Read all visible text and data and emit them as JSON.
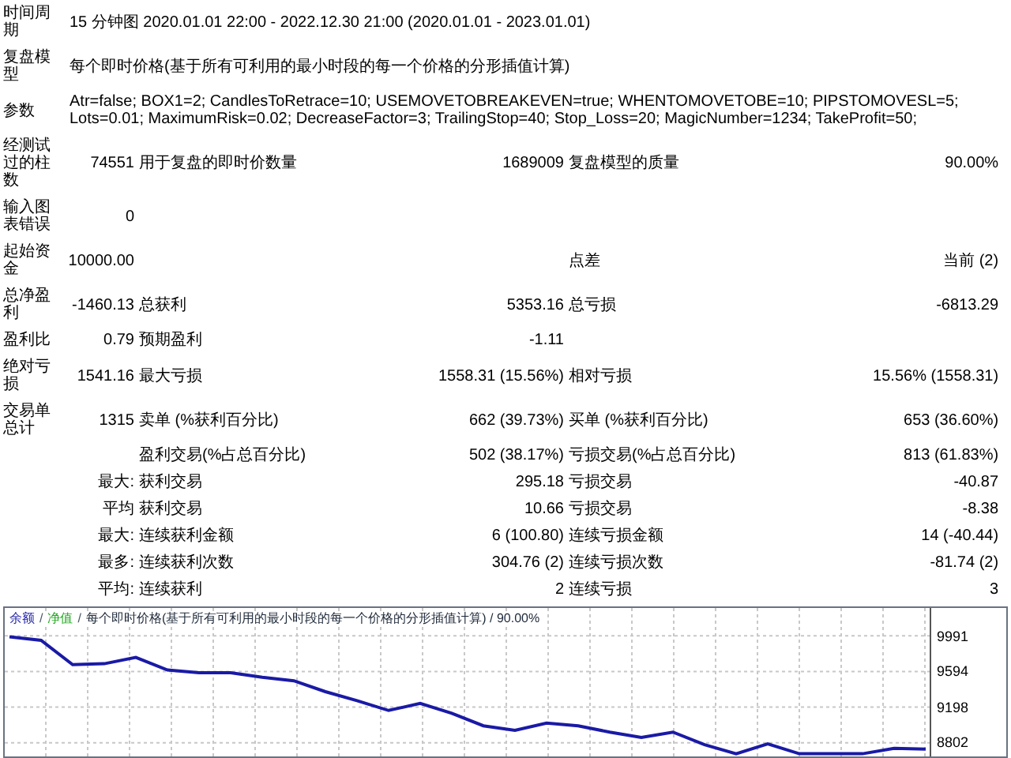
{
  "report": {
    "rows": [
      {
        "kind": "span",
        "label": "时间周期",
        "text": "15 分钟图 2020.01.01 22:00 - 2022.12.30 21:00 (2020.01.01 - 2023.01.01)"
      },
      {
        "kind": "span",
        "label": "复盘模型",
        "text": "每个即时价格(基于所有可利用的最小时段的每一个价格的分形插值计算)"
      },
      {
        "kind": "span",
        "label": "参数",
        "text": "Atr=false; BOX1=2; CandlesToRetrace=10; USEMOVETOBREAKEVEN=true; WHENTOMOVETOBE=10; PIPSTOMOVESL=5; Lots=0.01; MaximumRisk=0.02; DecreaseFactor=3; TrailingStop=40; Stop_Loss=20; MagicNumber=1234; TakeProfit=50;"
      },
      {
        "kind": "stats",
        "label": "经测试过的柱数",
        "value": "74551",
        "label_2": "用于复盘的即时价数量",
        "value_2": "1689009",
        "label_3": "复盘模型的质量",
        "value_3": "90.00%"
      },
      {
        "kind": "stats",
        "label": "输入图表错误",
        "value": "0"
      },
      {
        "kind": "stats",
        "label": "起始资金",
        "value": "10000.00",
        "label_3": "点差",
        "value_3": "当前 (2)"
      },
      {
        "kind": "stats",
        "label": "总净盈利",
        "value": "-1460.13",
        "label_2": "总获利",
        "value_2": "5353.16",
        "label_3": "总亏损",
        "value_3": "-6813.29"
      },
      {
        "kind": "stats",
        "label": "盈利比",
        "value": "0.79",
        "label_2": "预期盈利",
        "value_2": "-1.11"
      },
      {
        "kind": "stats",
        "label": "绝对亏损",
        "value": "1541.16",
        "label_2": "最大亏损",
        "value_2": "1558.31 (15.56%)",
        "label_3": "相对亏损",
        "value_3": "15.56% (1558.31)"
      },
      {
        "kind": "stats",
        "label": "交易单总计",
        "value": "1315",
        "label_2": "卖单 (%获利百分比)",
        "value_2": "662 (39.73%)",
        "label_3": "买单 (%获利百分比)",
        "value_3": "653 (36.60%)"
      },
      {
        "kind": "sub",
        "label_2": "盈利交易(%占总百分比)",
        "value_2": "502 (38.17%)",
        "label_3": "亏损交易(%占总百分比)",
        "value_3": "813 (61.83%)"
      },
      {
        "kind": "sub",
        "label": "最大:",
        "label_2": "获利交易",
        "value_2": "295.18",
        "label_3": "亏损交易",
        "value_3": "-40.87"
      },
      {
        "kind": "sub",
        "label": "平均",
        "label_2": "获利交易",
        "value_2": "10.66",
        "label_3": "亏损交易",
        "value_3": "-8.38"
      },
      {
        "kind": "sub",
        "label": "最大:",
        "label_2": "连续获利金额",
        "value_2": "6 (100.80)",
        "label_3": "连续亏损金额",
        "value_3": "14 (-40.44)"
      },
      {
        "kind": "sub",
        "label": "最多:",
        "label_2": "连续获利次数",
        "value_2": "304.76 (2)",
        "label_3": "连续亏损次数",
        "value_3": "-81.74 (2)"
      },
      {
        "kind": "sub",
        "label": "平均:",
        "label_2": "连续获利",
        "value_2": "2",
        "label_3": "连续亏损",
        "value_3": "3"
      }
    ]
  },
  "chart": {
    "separator": "/",
    "legend": [
      {
        "text": "净值",
        "color": "#22aa22"
      }
    ],
    "caption": "每个即时价格(基于所有可利用的最小时段的每一个价格的分形插值计算) / 90.00%",
    "chart_data": {
      "type": "line",
      "grid": true,
      "ylim": [
        8650,
        10300
      ],
      "yticks": [
        9991,
        9594,
        9198,
        8802
      ],
      "series": [
        {
          "name": "余额",
          "color": "#1a1aa6",
          "values": [
            9980,
            9940,
            9670,
            9680,
            9750,
            9610,
            9580,
            9580,
            9530,
            9490,
            9370,
            9270,
            9160,
            9240,
            9130,
            8990,
            8940,
            9020,
            8990,
            8920,
            8860,
            8920,
            8780,
            8680,
            8790,
            8680,
            8680,
            8680,
            8740,
            8730
          ]
        }
      ]
    }
  }
}
